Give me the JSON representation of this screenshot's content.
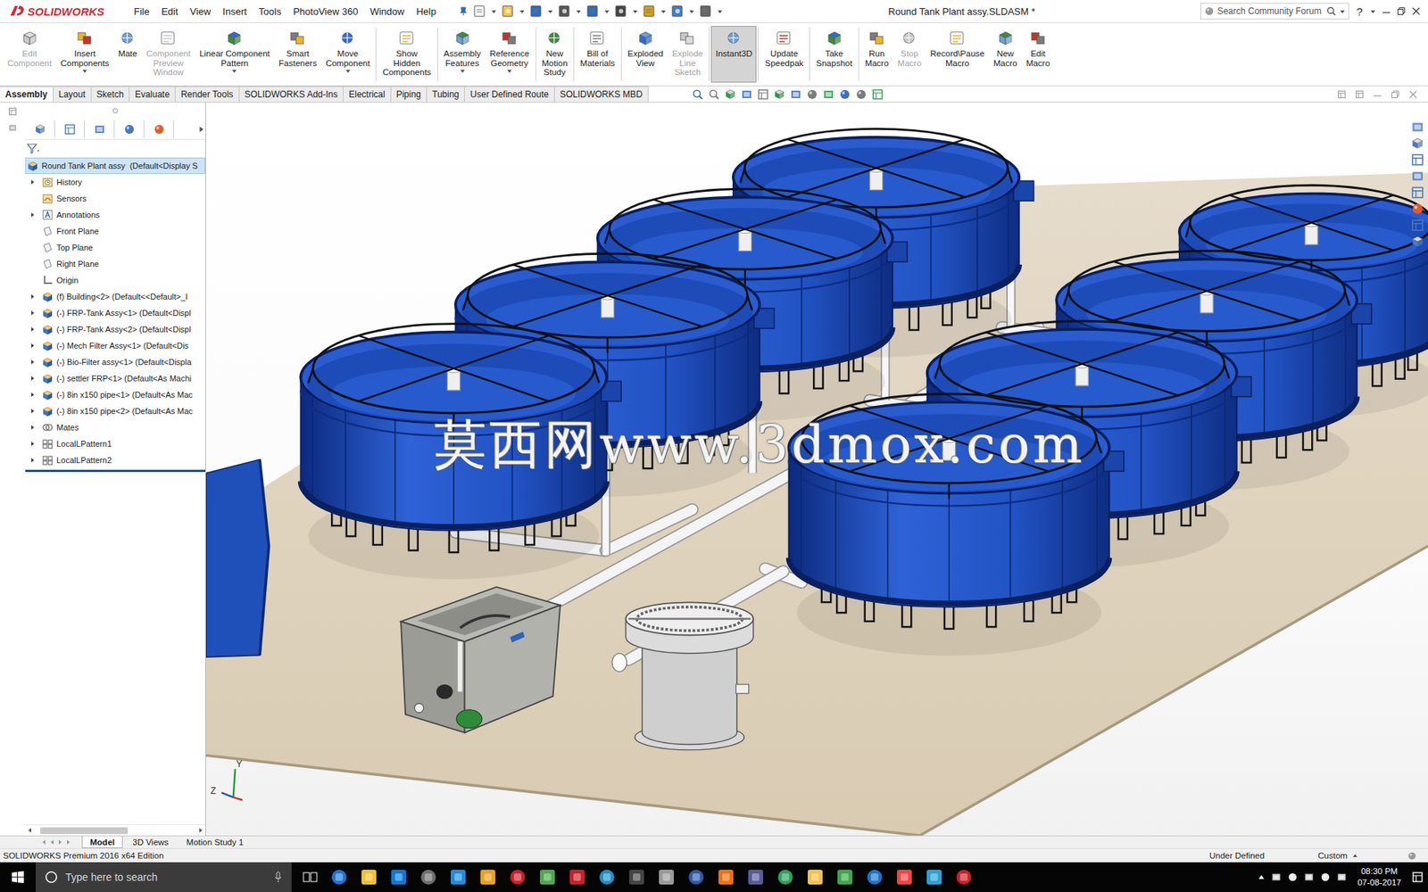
{
  "app": {
    "logo": "SOLIDWORKS"
  },
  "menu": [
    "File",
    "Edit",
    "View",
    "Insert",
    "Tools",
    "PhotoView 360",
    "Window",
    "Help"
  ],
  "window": {
    "title": "Round Tank Plant assy.SLDASM *"
  },
  "search": {
    "placeholder": "Search Community Forum"
  },
  "help": "?",
  "ribbon": [
    {
      "label": [
        "Edit",
        "Component"
      ],
      "disabled": true,
      "selected": false,
      "dropdown": false,
      "separator_after": false
    },
    {
      "label": [
        "Insert",
        "Components"
      ],
      "disabled": false,
      "selected": false,
      "dropdown": true,
      "separator_after": false
    },
    {
      "label": [
        "Mate"
      ],
      "disabled": false,
      "selected": false,
      "dropdown": false,
      "separator_after": false
    },
    {
      "label": [
        "Component",
        "Preview",
        "Window"
      ],
      "disabled": true,
      "selected": false,
      "dropdown": false,
      "separator_after": false
    },
    {
      "label": [
        "Linear Component",
        "Pattern"
      ],
      "disabled": false,
      "selected": false,
      "dropdown": true,
      "separator_after": false
    },
    {
      "label": [
        "Smart",
        "Fasteners"
      ],
      "disabled": false,
      "selected": false,
      "dropdown": false,
      "separator_after": false
    },
    {
      "label": [
        "Move",
        "Component"
      ],
      "disabled": false,
      "selected": false,
      "dropdown": true,
      "separator_after": true
    },
    {
      "label": [
        "Show",
        "Hidden",
        "Components"
      ],
      "disabled": false,
      "selected": false,
      "dropdown": false,
      "separator_after": true
    },
    {
      "label": [
        "Assembly",
        "Features"
      ],
      "disabled": false,
      "selected": false,
      "dropdown": true,
      "separator_after": false
    },
    {
      "label": [
        "Reference",
        "Geometry"
      ],
      "disabled": false,
      "selected": false,
      "dropdown": true,
      "separator_after": true
    },
    {
      "label": [
        "New",
        "Motion",
        "Study"
      ],
      "disabled": false,
      "selected": false,
      "dropdown": false,
      "separator_after": true
    },
    {
      "label": [
        "Bill of",
        "Materials"
      ],
      "disabled": false,
      "selected": false,
      "dropdown": false,
      "separator_after": true
    },
    {
      "label": [
        "Exploded",
        "View"
      ],
      "disabled": false,
      "selected": false,
      "dropdown": false,
      "separator_after": false
    },
    {
      "label": [
        "Explode",
        "Line",
        "Sketch"
      ],
      "disabled": true,
      "selected": false,
      "dropdown": false,
      "separator_after": true
    },
    {
      "label": [
        "Instant3D"
      ],
      "disabled": false,
      "selected": true,
      "dropdown": false,
      "separator_after": true
    },
    {
      "label": [
        "Update",
        "Speedpak"
      ],
      "disabled": false,
      "selected": false,
      "dropdown": false,
      "separator_after": true
    },
    {
      "label": [
        "Take",
        "Snapshot"
      ],
      "disabled": false,
      "selected": false,
      "dropdown": false,
      "separator_after": true
    },
    {
      "label": [
        "Run",
        "Macro"
      ],
      "disabled": false,
      "selected": false,
      "dropdown": false,
      "separator_after": false
    },
    {
      "label": [
        "Stop",
        "Macro"
      ],
      "disabled": true,
      "selected": false,
      "dropdown": false,
      "separator_after": false
    },
    {
      "label": [
        "Record\\Pause",
        "Macro"
      ],
      "disabled": false,
      "selected": false,
      "dropdown": false,
      "separator_after": false
    },
    {
      "label": [
        "New",
        "Macro"
      ],
      "disabled": false,
      "selected": false,
      "dropdown": false,
      "separator_after": false
    },
    {
      "label": [
        "Edit",
        "Macro"
      ],
      "disabled": false,
      "selected": false,
      "dropdown": false,
      "separator_after": false
    }
  ],
  "tabs": [
    {
      "label": "Assembly",
      "selected": true
    },
    {
      "label": "Layout",
      "selected": false
    },
    {
      "label": "Sketch",
      "selected": false
    },
    {
      "label": "Evaluate",
      "selected": false
    },
    {
      "label": "Render Tools",
      "selected": false
    },
    {
      "label": "SOLIDWORKS Add-Ins",
      "selected": false
    },
    {
      "label": "Electrical",
      "selected": false
    },
    {
      "label": "Piping",
      "selected": false
    },
    {
      "label": "Tubing",
      "selected": false
    },
    {
      "label": "User Defined Route",
      "selected": false
    },
    {
      "label": "SOLIDWORKS MBD",
      "selected": false
    }
  ],
  "tree": {
    "items": [
      {
        "label": "Round Tank Plant assy  (Default<Display S",
        "kind": "root",
        "expandable": false,
        "selected": true
      },
      {
        "label": "History",
        "kind": "history",
        "expandable": true,
        "selected": false
      },
      {
        "label": "Sensors",
        "kind": "sensors",
        "expandable": false,
        "selected": false
      },
      {
        "label": "Annotations",
        "kind": "annotations",
        "expandable": true,
        "selected": false
      },
      {
        "label": "Front Plane",
        "kind": "plane",
        "expandable": false,
        "selected": false
      },
      {
        "label": "Top Plane",
        "kind": "plane",
        "expandable": false,
        "selected": false
      },
      {
        "label": "Right Plane",
        "kind": "plane",
        "expandable": false,
        "selected": false
      },
      {
        "label": "Origin",
        "kind": "origin",
        "expandable": false,
        "selected": false
      },
      {
        "label": "(f) Building<2> (Default<<Default>_I",
        "kind": "component",
        "expandable": true,
        "selected": false
      },
      {
        "label": "(-) FRP-Tank Assy<1> (Default<Displ",
        "kind": "component",
        "expandable": true,
        "selected": false
      },
      {
        "label": "(-) FRP-Tank Assy<2> (Default<Displ",
        "kind": "component",
        "expandable": true,
        "selected": false
      },
      {
        "label": "(-) Mech Filter Assy<1> (Default<Dis",
        "kind": "component",
        "expandable": true,
        "selected": false
      },
      {
        "label": "(-) Bio-Filter assy<1> (Default<Displa",
        "kind": "component",
        "expandable": true,
        "selected": false
      },
      {
        "label": "(-) settler FRP<1> (Default<As Machi",
        "kind": "component",
        "expandable": true,
        "selected": false
      },
      {
        "label": "(-) 8in x150 pipe<1> (Default<As Mac",
        "kind": "component",
        "expandable": true,
        "selected": false
      },
      {
        "label": "(-) 8in x150 pipe<2> (Default<As Mac",
        "kind": "component",
        "expandable": true,
        "selected": false
      },
      {
        "label": "Mates",
        "kind": "mates",
        "expandable": true,
        "selected": false
      },
      {
        "label": "LocalLPattern1",
        "kind": "pattern",
        "expandable": true,
        "selected": false
      },
      {
        "label": "LocalLPattern2",
        "kind": "pattern",
        "expandable": true,
        "selected": false
      }
    ]
  },
  "panel_tabs": [
    {
      "label": "Model",
      "selected": true
    },
    {
      "label": "3D Views",
      "selected": false
    },
    {
      "label": "Motion Study 1",
      "selected": false
    }
  ],
  "viewport": {
    "watermark": "莫西网www.3dmox.com",
    "axes": [
      "Z",
      "Y"
    ]
  },
  "status_bar": {
    "edition": "SOLIDWORKS Premium 2016 x64 Edition",
    "state": "Under Defined",
    "units": "Custom"
  },
  "taskbar": {
    "search_placeholder": "Type here to search",
    "time": "08:30 PM",
    "date": "07-08-2017"
  }
}
